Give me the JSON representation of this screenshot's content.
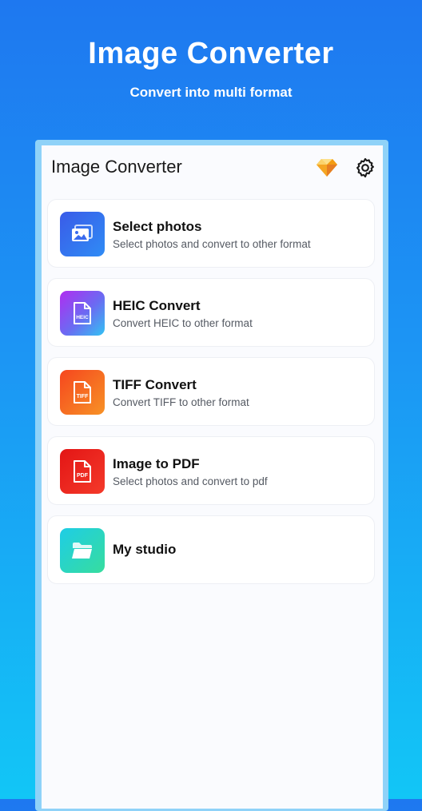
{
  "hero": {
    "title": "Image Converter",
    "subtitle": "Convert into multi format"
  },
  "app": {
    "title": "Image Converter",
    "icons": [
      "premium-diamond-icon",
      "gear-icon"
    ]
  },
  "menu": [
    {
      "title": "Select photos",
      "subtitle": "Select photos and convert to other format",
      "icon": "photos-icon"
    },
    {
      "title": "HEIC Convert",
      "subtitle": "Convert HEIC to other format",
      "icon": "heic-file-icon",
      "badge": "HEIC"
    },
    {
      "title": "TIFF Convert",
      "subtitle": "Convert TIFF to other format",
      "icon": "tiff-file-icon",
      "badge": "TIFF"
    },
    {
      "title": "Image to PDF",
      "subtitle": "Select photos and convert to pdf",
      "icon": "pdf-file-icon",
      "badge": "PDF"
    },
    {
      "title": "My studio",
      "subtitle": "",
      "icon": "folder-icon"
    }
  ],
  "colors": {
    "background_top": "#1E78F0",
    "background_bottom": "#12C6F6",
    "photos": "#3A5BE8",
    "heic": "#B02CF0",
    "tiff": "#F6461E",
    "pdf": "#E31515",
    "studio": "#1ECDE6",
    "premium": "#F5A623"
  }
}
